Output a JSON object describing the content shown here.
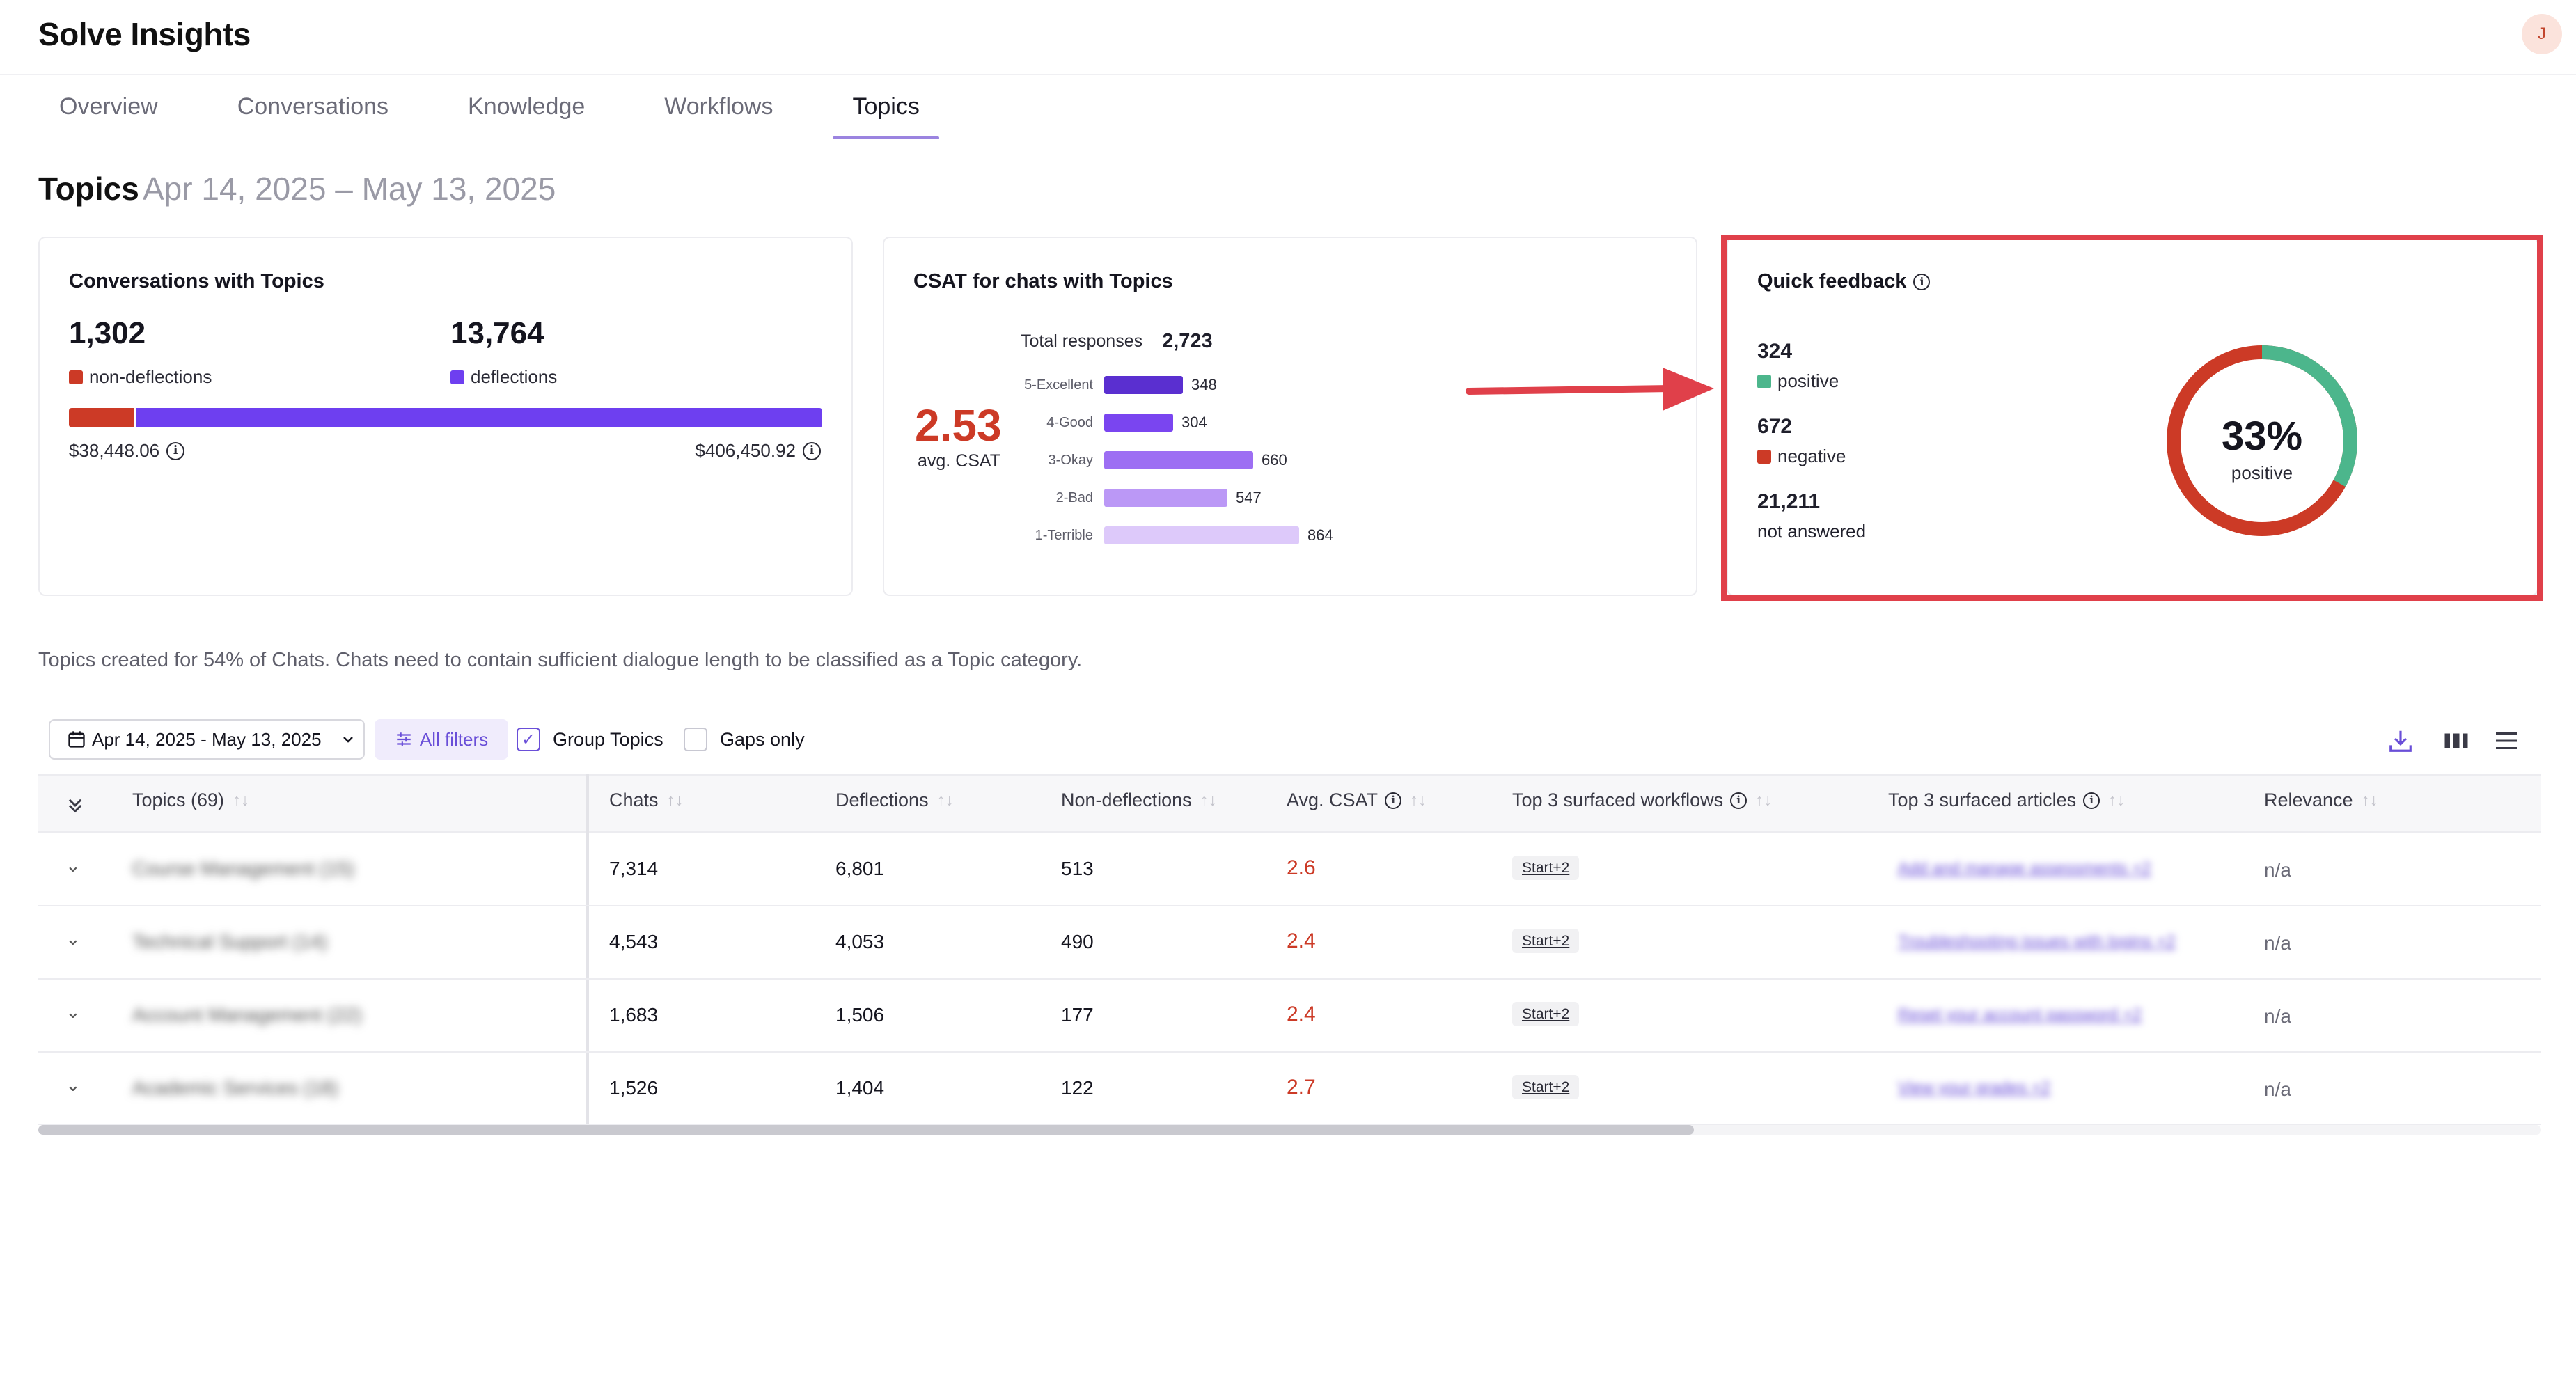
{
  "app": {
    "title": "Solve Insights",
    "avatar_initial": "J"
  },
  "tabs": [
    {
      "label": "Overview"
    },
    {
      "label": "Conversations"
    },
    {
      "label": "Knowledge"
    },
    {
      "label": "Workflows"
    },
    {
      "label": "Topics",
      "active": true
    }
  ],
  "page": {
    "title": "Topics",
    "date_range": "Apr 14, 2025 – May 13, 2025"
  },
  "cards": {
    "conversations": {
      "title": "Conversations with Topics",
      "non_deflections_count": "1,302",
      "non_deflections_label": "non-deflections",
      "deflections_count": "13,764",
      "deflections_label": "deflections",
      "non_deflections_value": "$38,448.06",
      "deflections_value": "$406,450.92",
      "non_deflection_share": 0.086,
      "colors": {
        "non_deflections": "#cc3a26",
        "deflections": "#6e3ff0"
      }
    },
    "csat": {
      "title": "CSAT for chats with Topics",
      "avg": "2.53",
      "avg_label": "avg. CSAT",
      "total_label": "Total responses",
      "total": "2,723",
      "bars": [
        {
          "label": "5-Excellent",
          "value": 348,
          "display": "348",
          "color": "#5a2fd0"
        },
        {
          "label": "4-Good",
          "value": 304,
          "display": "304",
          "color": "#7a45f0"
        },
        {
          "label": "3-Okay",
          "value": 660,
          "display": "660",
          "color": "#9d6ef3"
        },
        {
          "label": "2-Bad",
          "value": 547,
          "display": "547",
          "color": "#bb98f6"
        },
        {
          "label": "1-Terrible",
          "value": 864,
          "display": "864",
          "color": "#ddc9fa"
        }
      ]
    },
    "quick_feedback": {
      "title": "Quick feedback",
      "positive_count": "324",
      "positive_label": "positive",
      "negative_count": "672",
      "negative_label": "negative",
      "not_answered_count": "21,211",
      "not_answered_label": "not answered",
      "donut_percent": "33%",
      "donut_label": "positive",
      "positive_share": 0.33,
      "colors": {
        "positive": "#4cb68c",
        "negative": "#cc3a26"
      }
    }
  },
  "note": "Topics created for 54% of Chats. Chats need to contain sufficient dialogue length to be classified as a Topic category.",
  "filters": {
    "date": "Apr 14, 2025 - May 13, 2025",
    "all_filters": "All filters",
    "group_topics": "Group Topics",
    "group_topics_checked": true,
    "gaps_only": "Gaps only",
    "gaps_only_checked": false
  },
  "table": {
    "columns": {
      "topics": "Topics (69)",
      "chats": "Chats",
      "deflections": "Deflections",
      "non_deflections": "Non-deflections",
      "avg_csat": "Avg. CSAT",
      "workflows": "Top 3 surfaced workflows",
      "articles": "Top 3 surfaced articles",
      "relevance": "Relevance"
    },
    "rows": [
      {
        "topic": "Course Management (15)",
        "chats": "7,314",
        "deflections": "6,801",
        "non_deflections": "513",
        "csat": "2.6",
        "workflow": "Start+2",
        "article": "Add and manage assessments +2",
        "relevance": "n/a"
      },
      {
        "topic": "Technical Support (14)",
        "chats": "4,543",
        "deflections": "4,053",
        "non_deflections": "490",
        "csat": "2.4",
        "workflow": "Start+2",
        "article": "Troubleshooting issues with logins +2",
        "relevance": "n/a"
      },
      {
        "topic": "Account Management (22)",
        "chats": "1,683",
        "deflections": "1,506",
        "non_deflections": "177",
        "csat": "2.4",
        "workflow": "Start+2",
        "article": "Reset your account password +2",
        "relevance": "n/a"
      },
      {
        "topic": "Academic Services (18)",
        "chats": "1,526",
        "deflections": "1,404",
        "non_deflections": "122",
        "csat": "2.7",
        "workflow": "Start+2",
        "article": "View your grades +2",
        "relevance": "n/a"
      }
    ]
  }
}
